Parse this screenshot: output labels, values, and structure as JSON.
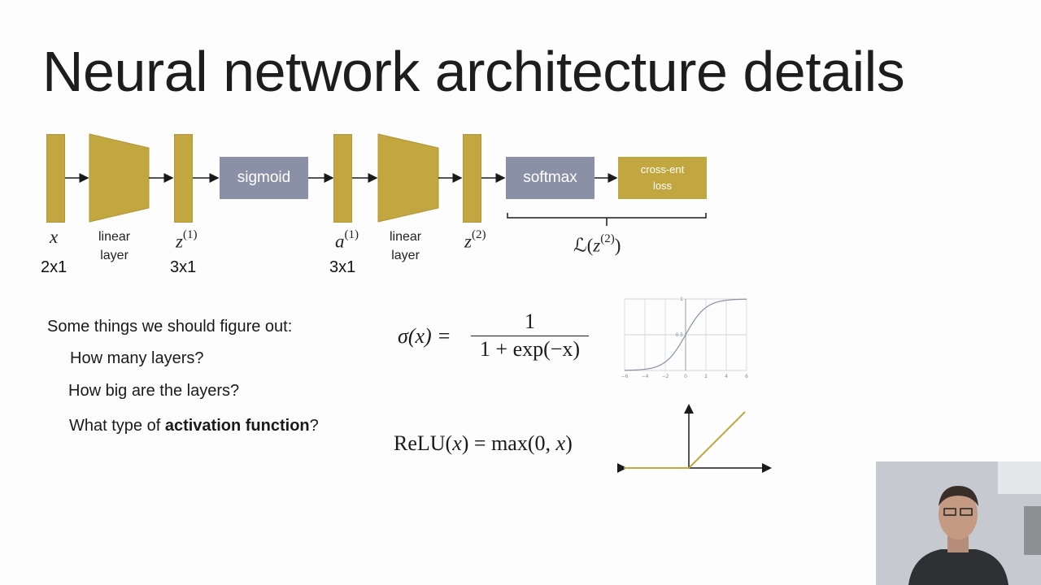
{
  "slide": {
    "title": "Neural network architecture details"
  },
  "diagram": {
    "labels": {
      "x": "x",
      "x_dim": "2x1",
      "linear1_line1": "linear",
      "linear1_line2": "layer",
      "z1_base": "z",
      "z1_sup": "(1)",
      "z1_dim": "3x1",
      "a1_base": "a",
      "a1_sup": "(1)",
      "a1_dim": "3x1",
      "linear2_line1": "linear",
      "linear2_line2": "layer",
      "z2_base": "z",
      "z2_sup": "(2)",
      "loss_calL": "ℒ",
      "loss_open": "(",
      "loss_z": "z",
      "loss_sup": "(2)",
      "loss_close": ")"
    },
    "boxes": {
      "sigmoid": "sigmoid",
      "softmax": "softmax",
      "crossent_line1": "cross-ent",
      "crossent_line2": "loss"
    },
    "colors": {
      "vector": "#c2a640",
      "gray_box": "#8a90a6",
      "arrow": "#1a1a1a"
    }
  },
  "questions": {
    "intro": "Some things we should figure out:",
    "q1": "How many layers?",
    "q2": "How big are the layers?",
    "q3_prefix": "What type of ",
    "q3_bold": "activation function",
    "q3_suffix": "?"
  },
  "equations": {
    "sigmoid_lhs": "σ(x) =",
    "sigmoid_num": "1",
    "sigmoid_den": "1 + exp(−x)",
    "relu_lhs_fn": "ReLU(",
    "relu_lhs_x": "x",
    "relu_lhs_close": ")",
    "relu_eq": " = max(0, ",
    "relu_x": "x",
    "relu_close": ")"
  },
  "sigmoid_plot": {
    "x_ticks": [
      "−6",
      "−4",
      "−2",
      "0",
      "2",
      "4",
      "6"
    ],
    "y_ticks": [
      "0.5",
      "1"
    ],
    "x_range": [
      -6,
      6
    ],
    "y_range": [
      0,
      1
    ]
  }
}
